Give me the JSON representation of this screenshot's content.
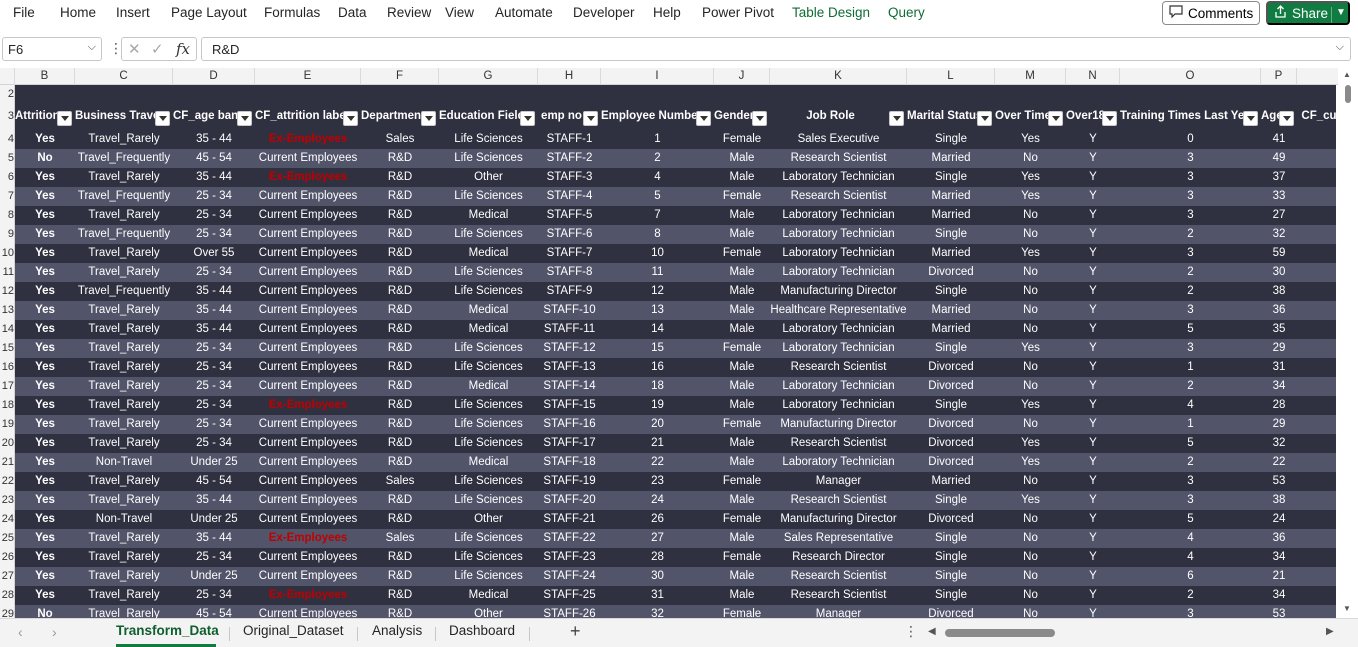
{
  "menu": {
    "items": [
      "File",
      "Home",
      "Insert",
      "Page Layout",
      "Formulas",
      "Data",
      "Review",
      "View",
      "Automate",
      "Developer",
      "Help",
      "Power Pivot"
    ],
    "context_items": [
      "Table Design",
      "Query"
    ],
    "comments_label": "Comments",
    "share_label": "Share"
  },
  "formula_bar": {
    "name_box": "F6",
    "fx": "fx",
    "formula": "R&D"
  },
  "columns": [
    "B",
    "C",
    "D",
    "E",
    "F",
    "G",
    "H",
    "I",
    "J",
    "K",
    "L",
    "M",
    "N",
    "O",
    "P"
  ],
  "row_numbers": [
    "2",
    "3",
    "4",
    "5",
    "6",
    "7",
    "8",
    "9",
    "10",
    "11",
    "12",
    "13",
    "14",
    "15",
    "16",
    "17",
    "18",
    "19",
    "20",
    "21",
    "22",
    "23",
    "24",
    "25",
    "26",
    "27",
    "28",
    "29"
  ],
  "table_headers": [
    "Attrition",
    "Business Travel",
    "CF_age band",
    "CF_attrition label",
    "Department",
    "Education Field",
    "emp no",
    "Employee Number",
    "Gender",
    "Job Role",
    "Marital Status",
    "Over Time",
    "Over18",
    "Training Times Last Year",
    "Age",
    "CF_cu"
  ],
  "rows": [
    [
      "Yes",
      "Travel_Rarely",
      "35 - 44",
      "Ex-Employees",
      "Sales",
      "Life Sciences",
      "STAFF-1",
      "1",
      "Female",
      "Sales Executive",
      "Single",
      "Yes",
      "Y",
      "0",
      "41"
    ],
    [
      "No",
      "Travel_Frequently",
      "45 - 54",
      "Current Employees",
      "R&D",
      "Life Sciences",
      "STAFF-2",
      "2",
      "Male",
      "Research Scientist",
      "Married",
      "No",
      "Y",
      "3",
      "49"
    ],
    [
      "Yes",
      "Travel_Rarely",
      "35 - 44",
      "Ex-Employees",
      "R&D",
      "Other",
      "STAFF-3",
      "4",
      "Male",
      "Laboratory Technician",
      "Single",
      "Yes",
      "Y",
      "3",
      "37"
    ],
    [
      "Yes",
      "Travel_Frequently",
      "25 - 34",
      "Current Employees",
      "R&D",
      "Life Sciences",
      "STAFF-4",
      "5",
      "Female",
      "Research Scientist",
      "Married",
      "Yes",
      "Y",
      "3",
      "33"
    ],
    [
      "Yes",
      "Travel_Rarely",
      "25 - 34",
      "Current Employees",
      "R&D",
      "Medical",
      "STAFF-5",
      "7",
      "Male",
      "Laboratory Technician",
      "Married",
      "No",
      "Y",
      "3",
      "27"
    ],
    [
      "Yes",
      "Travel_Frequently",
      "25 - 34",
      "Current Employees",
      "R&D",
      "Life Sciences",
      "STAFF-6",
      "8",
      "Male",
      "Laboratory Technician",
      "Single",
      "No",
      "Y",
      "2",
      "32"
    ],
    [
      "Yes",
      "Travel_Rarely",
      "Over 55",
      "Current Employees",
      "R&D",
      "Medical",
      "STAFF-7",
      "10",
      "Female",
      "Laboratory Technician",
      "Married",
      "Yes",
      "Y",
      "3",
      "59"
    ],
    [
      "Yes",
      "Travel_Rarely",
      "25 - 34",
      "Current Employees",
      "R&D",
      "Life Sciences",
      "STAFF-8",
      "11",
      "Male",
      "Laboratory Technician",
      "Divorced",
      "No",
      "Y",
      "2",
      "30"
    ],
    [
      "Yes",
      "Travel_Frequently",
      "35 - 44",
      "Current Employees",
      "R&D",
      "Life Sciences",
      "STAFF-9",
      "12",
      "Male",
      "Manufacturing Director",
      "Single",
      "No",
      "Y",
      "2",
      "38"
    ],
    [
      "Yes",
      "Travel_Rarely",
      "35 - 44",
      "Current Employees",
      "R&D",
      "Medical",
      "STAFF-10",
      "13",
      "Male",
      "Healthcare Representative",
      "Married",
      "No",
      "Y",
      "3",
      "36"
    ],
    [
      "Yes",
      "Travel_Rarely",
      "35 - 44",
      "Current Employees",
      "R&D",
      "Medical",
      "STAFF-11",
      "14",
      "Male",
      "Laboratory Technician",
      "Married",
      "No",
      "Y",
      "5",
      "35"
    ],
    [
      "Yes",
      "Travel_Rarely",
      "25 - 34",
      "Current Employees",
      "R&D",
      "Life Sciences",
      "STAFF-12",
      "15",
      "Female",
      "Laboratory Technician",
      "Single",
      "Yes",
      "Y",
      "3",
      "29"
    ],
    [
      "Yes",
      "Travel_Rarely",
      "25 - 34",
      "Current Employees",
      "R&D",
      "Life Sciences",
      "STAFF-13",
      "16",
      "Male",
      "Research Scientist",
      "Divorced",
      "No",
      "Y",
      "1",
      "31"
    ],
    [
      "Yes",
      "Travel_Rarely",
      "25 - 34",
      "Current Employees",
      "R&D",
      "Medical",
      "STAFF-14",
      "18",
      "Male",
      "Laboratory Technician",
      "Divorced",
      "No",
      "Y",
      "2",
      "34"
    ],
    [
      "Yes",
      "Travel_Rarely",
      "25 - 34",
      "Ex-Employees",
      "R&D",
      "Life Sciences",
      "STAFF-15",
      "19",
      "Male",
      "Laboratory Technician",
      "Single",
      "Yes",
      "Y",
      "4",
      "28"
    ],
    [
      "Yes",
      "Travel_Rarely",
      "25 - 34",
      "Current Employees",
      "R&D",
      "Life Sciences",
      "STAFF-16",
      "20",
      "Female",
      "Manufacturing Director",
      "Divorced",
      "No",
      "Y",
      "1",
      "29"
    ],
    [
      "Yes",
      "Travel_Rarely",
      "25 - 34",
      "Current Employees",
      "R&D",
      "Life Sciences",
      "STAFF-17",
      "21",
      "Male",
      "Research Scientist",
      "Divorced",
      "Yes",
      "Y",
      "5",
      "32"
    ],
    [
      "Yes",
      "Non-Travel",
      "Under 25",
      "Current Employees",
      "R&D",
      "Medical",
      "STAFF-18",
      "22",
      "Male",
      "Laboratory Technician",
      "Divorced",
      "Yes",
      "Y",
      "2",
      "22"
    ],
    [
      "Yes",
      "Travel_Rarely",
      "45 - 54",
      "Current Employees",
      "Sales",
      "Life Sciences",
      "STAFF-19",
      "23",
      "Female",
      "Manager",
      "Married",
      "No",
      "Y",
      "3",
      "53"
    ],
    [
      "Yes",
      "Travel_Rarely",
      "35 - 44",
      "Current Employees",
      "R&D",
      "Life Sciences",
      "STAFF-20",
      "24",
      "Male",
      "Research Scientist",
      "Single",
      "Yes",
      "Y",
      "3",
      "38"
    ],
    [
      "Yes",
      "Non-Travel",
      "Under 25",
      "Current Employees",
      "R&D",
      "Other",
      "STAFF-21",
      "26",
      "Female",
      "Manufacturing Director",
      "Divorced",
      "No",
      "Y",
      "5",
      "24"
    ],
    [
      "Yes",
      "Travel_Rarely",
      "35 - 44",
      "Ex-Employees",
      "Sales",
      "Life Sciences",
      "STAFF-22",
      "27",
      "Male",
      "Sales Representative",
      "Single",
      "No",
      "Y",
      "4",
      "36"
    ],
    [
      "Yes",
      "Travel_Rarely",
      "25 - 34",
      "Current Employees",
      "R&D",
      "Life Sciences",
      "STAFF-23",
      "28",
      "Female",
      "Research Director",
      "Single",
      "No",
      "Y",
      "4",
      "34"
    ],
    [
      "Yes",
      "Travel_Rarely",
      "Under 25",
      "Current Employees",
      "R&D",
      "Life Sciences",
      "STAFF-24",
      "30",
      "Male",
      "Research Scientist",
      "Single",
      "No",
      "Y",
      "6",
      "21"
    ],
    [
      "Yes",
      "Travel_Rarely",
      "25 - 34",
      "Ex-Employees",
      "R&D",
      "Medical",
      "STAFF-25",
      "31",
      "Male",
      "Research Scientist",
      "Single",
      "No",
      "Y",
      "2",
      "34"
    ],
    [
      "No",
      "Travel_Rarely",
      "45 - 54",
      "Current Employees",
      "R&D",
      "Other",
      "STAFF-26",
      "32",
      "Female",
      "Manager",
      "Divorced",
      "No",
      "Y",
      "3",
      "53"
    ]
  ],
  "sheet_tabs": [
    "Transform_Data",
    "Original_Dataset",
    "Analysis",
    "Dashboard"
  ],
  "active_sheet": "Transform_Data",
  "colors": {
    "accent_green": "#107c41",
    "table_dark": "#2f3040",
    "table_band": "#52546a",
    "ex_employee_red": "#c00000"
  }
}
